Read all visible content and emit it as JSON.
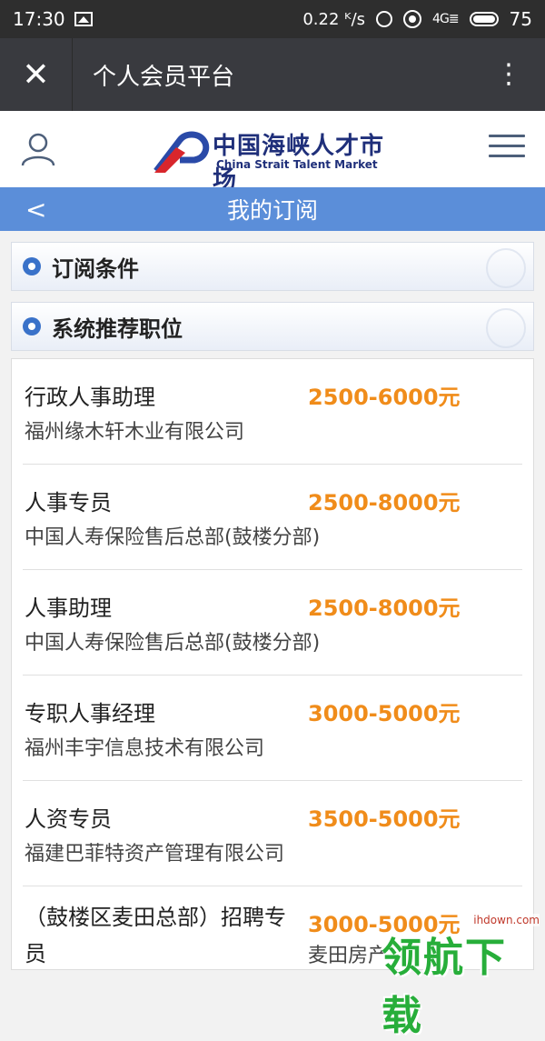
{
  "status_bar": {
    "time": "17:30",
    "net_speed": "0.22 ᴷ/s",
    "signal_label": "4G",
    "battery": "75"
  },
  "app_bar": {
    "title": "个人会员平台",
    "close_icon": "close-icon",
    "more_icon": "more-vertical-icon"
  },
  "site_header": {
    "logo_cn": "中国海峡人才市场",
    "logo_en": "China Strait Talent Market",
    "user_icon": "user-icon",
    "menu_icon": "menu-icon"
  },
  "page_bar": {
    "title": "我的订阅",
    "back": "<"
  },
  "sections": [
    {
      "label": "订阅条件"
    },
    {
      "label": "系统推荐职位"
    }
  ],
  "jobs": [
    {
      "title": "行政人事助理",
      "salary": "2500-6000元",
      "company": "福州缘木轩木业有限公司"
    },
    {
      "title": "人事专员",
      "salary": "2500-8000元",
      "company": "中国人寿保险售后总部(鼓楼分部)"
    },
    {
      "title": "人事助理",
      "salary": "2500-8000元",
      "company": "中国人寿保险售后总部(鼓楼分部)"
    },
    {
      "title": "专职人事经理",
      "salary": "3000-5000元",
      "company": "福州丰宇信息技术有限公司"
    },
    {
      "title": "人资专员",
      "salary": "3500-5000元",
      "company": "福建巴菲特资产管理有限公司"
    },
    {
      "title": "（鼓楼区麦田总部）招聘专员",
      "salary": "3000-5000元",
      "company": "麦田房产"
    }
  ],
  "watermark": {
    "url": "ihdown.com",
    "text": "领航下载"
  },
  "colors": {
    "salary": "#f08c1a",
    "page_bar": "#5b8ed9",
    "app_bar": "#393a3f",
    "status_bar": "#2e2e2e"
  }
}
